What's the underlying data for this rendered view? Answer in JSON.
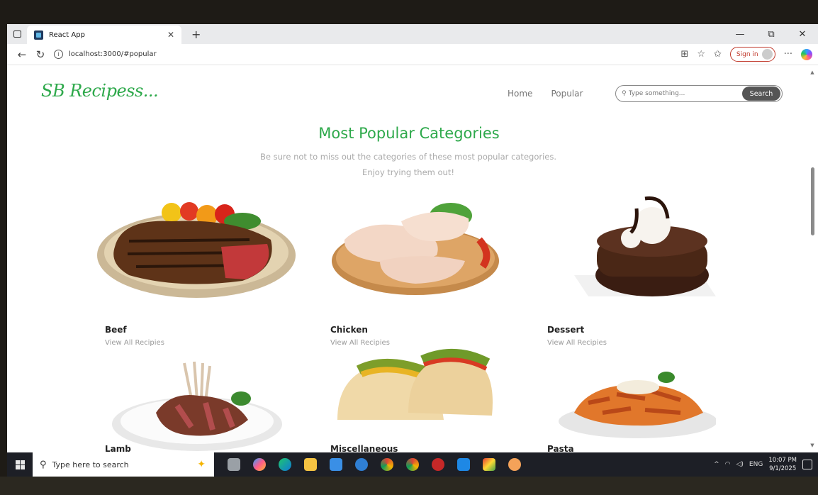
{
  "browser": {
    "tab_title": "React App",
    "url": "localhost:3000/#popular",
    "sign_in_label": "Sign in"
  },
  "site": {
    "logo": "SB Recipess...",
    "nav": [
      "Home",
      "Popular"
    ],
    "search_placeholder": "Type something...",
    "search_button": "Search"
  },
  "section": {
    "title": "Most Popular Categories",
    "subtitle": "Be sure not to miss out the categories of these most popular categories. Enjoy trying them out!"
  },
  "categories": [
    {
      "name": "Beef",
      "link": "View All Recipies"
    },
    {
      "name": "Chicken",
      "link": "View All Recipies"
    },
    {
      "name": "Dessert",
      "link": "View All Recipies"
    },
    {
      "name": "Lamb",
      "link": ""
    },
    {
      "name": "Miscellaneous",
      "link": ""
    },
    {
      "name": "Pasta",
      "link": ""
    }
  ],
  "taskbar": {
    "search_placeholder": "Type here to search",
    "language": "ENG",
    "time": "10:07 PM",
    "date": "9/1/2025"
  }
}
